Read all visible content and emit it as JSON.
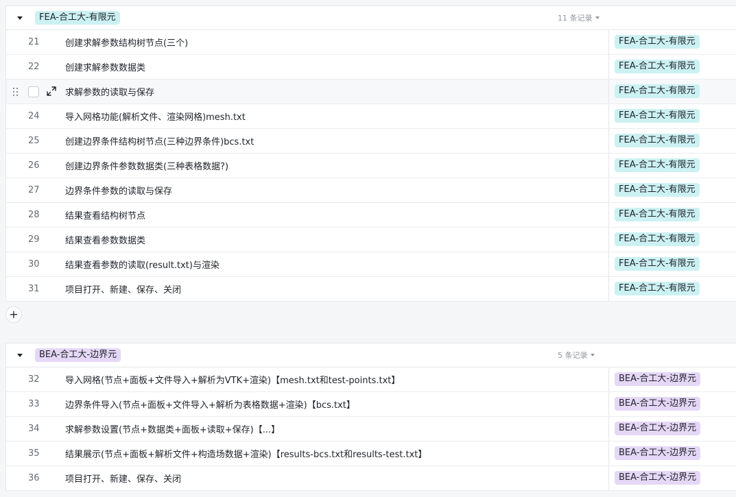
{
  "groups": [
    {
      "tag": "FEA-合工大-有限元",
      "count": "11 条记录",
      "tag_color": "#ccf1f3",
      "rows": [
        {
          "num": "21",
          "title": "创建求解参数结构树节点(三个)",
          "tag": "FEA-合工大-有限元"
        },
        {
          "num": "22",
          "title": "创建求解参数数据类",
          "tag": "FEA-合工大-有限元"
        },
        {
          "num": "",
          "title": "求解参数的读取与保存",
          "tag": "FEA-合工大-有限元"
        },
        {
          "num": "24",
          "title": "导入网格功能(解析文件、渲染网格)mesh.txt",
          "tag": "FEA-合工大-有限元"
        },
        {
          "num": "25",
          "title": "创建边界条件结构树节点(三种边界条件)bcs.txt",
          "tag": "FEA-合工大-有限元"
        },
        {
          "num": "26",
          "title": "创建边界条件参数数据类(三种表格数据?)",
          "tag": "FEA-合工大-有限元"
        },
        {
          "num": "27",
          "title": "边界条件参数的读取与保存",
          "tag": "FEA-合工大-有限元"
        },
        {
          "num": "28",
          "title": "结果查看结构树节点",
          "tag": "FEA-合工大-有限元"
        },
        {
          "num": "29",
          "title": "结果查看参数数据类",
          "tag": "FEA-合工大-有限元"
        },
        {
          "num": "30",
          "title": "结果查看参数的读取(result.txt)与渲染",
          "tag": "FEA-合工大-有限元"
        },
        {
          "num": "31",
          "title": "项目打开、新建、保存、关闭",
          "tag": "FEA-合工大-有限元"
        }
      ]
    },
    {
      "tag": "BEA-合工大-边界元",
      "count": "5 条记录",
      "tag_color": "#e5d7f6",
      "rows": [
        {
          "num": "32",
          "title": "导入网格(节点+面板+文件导入+解析为VTK+渲染)【mesh.txt和test-points.txt】",
          "tag": "BEA-合工大-边界元"
        },
        {
          "num": "33",
          "title": "边界条件导入(节点+面板+文件导入+解析为表格数据+渲染)【bcs.txt】",
          "tag": "BEA-合工大-边界元"
        },
        {
          "num": "34",
          "title": "求解参数设置(节点+数据类+面板+读取+保存)【...】",
          "tag": "BEA-合工大-边界元"
        },
        {
          "num": "35",
          "title": "结果展示(节点+面板+解析文件+构造场数据+渲染)【results-bcs.txt和results-test.txt】",
          "tag": "BEA-合工大-边界元"
        },
        {
          "num": "36",
          "title": "项目打开、新建、保存、关闭",
          "tag": "BEA-合工大-边界元"
        }
      ]
    }
  ],
  "add_button": "+",
  "icons": {
    "collapse": "caret-down-icon",
    "drag": "drag-handle-icon",
    "expand": "expand-arrows-icon",
    "count_menu": "chevron-down-icon"
  }
}
